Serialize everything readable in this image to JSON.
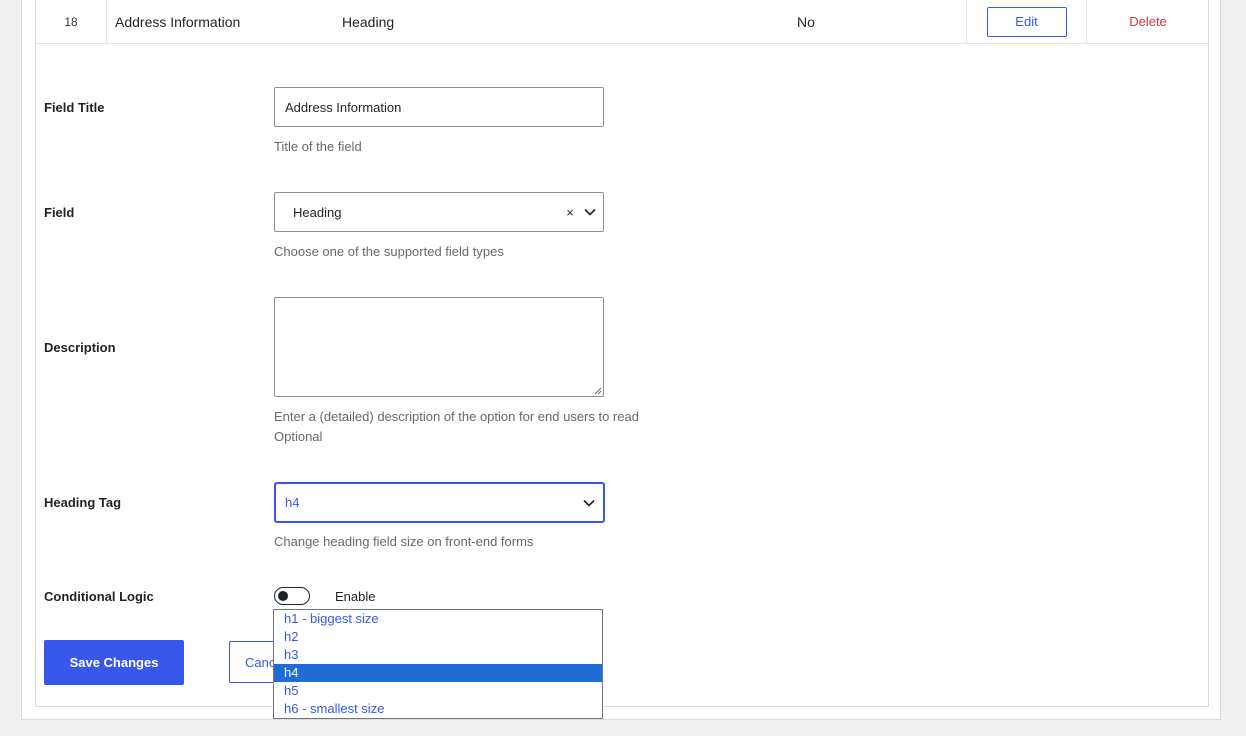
{
  "table_row": {
    "number": "18",
    "title": "Address Information",
    "type": "Heading",
    "required": "No",
    "edit_label": "Edit",
    "delete_label": "Delete"
  },
  "form": {
    "field_title": {
      "label": "Field Title",
      "value": "Address Information",
      "hint": "Title of the field"
    },
    "field": {
      "label": "Field",
      "value": "Heading",
      "clear_symbol": "×",
      "hint": "Choose one of the supported field types"
    },
    "description": {
      "label": "Description",
      "value": "",
      "hint": "Enter a (detailed) description of the option for end users to read",
      "hint2": "Optional"
    },
    "heading_tag": {
      "label": "Heading Tag",
      "value": "h4",
      "hint": "Change heading field size on front-end forms",
      "options": [
        "h1 - biggest size",
        "h2",
        "h3",
        "h4",
        "h5",
        "h6 - smallest size"
      ],
      "selected_index": 3
    },
    "conditional_logic": {
      "label": "Conditional Logic",
      "toggle_label": "Enable",
      "enabled": false
    }
  },
  "actions": {
    "save_label": "Save Changes",
    "cancel_label": "Canc"
  },
  "colors": {
    "accent": "#3858e9",
    "delete": "#d63638",
    "option_highlight": "#1e6cd4"
  }
}
